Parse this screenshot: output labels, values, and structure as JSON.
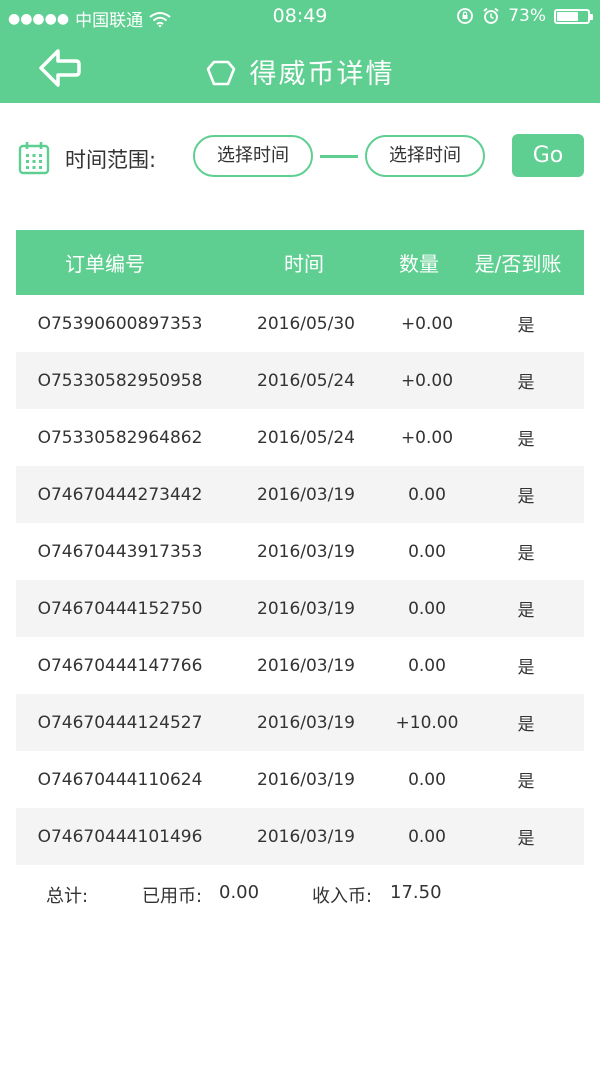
{
  "status_bar": {
    "carrier": "中国联通",
    "time": "08:49",
    "battery": "73%",
    "battery_level": 0.73
  },
  "header": {
    "title": "得威币详情"
  },
  "filter": {
    "label": "时间范围:",
    "start_placeholder": "选择时间",
    "end_placeholder": "选择时间",
    "go_label": "Go"
  },
  "table": {
    "columns": [
      "订单编号",
      "时间",
      "数量",
      "是/否到账"
    ],
    "rows": [
      {
        "order": "O75390600897353",
        "time": "2016/05/30",
        "qty": "+0.00",
        "status": "是"
      },
      {
        "order": "O75330582950958",
        "time": "2016/05/24",
        "qty": "+0.00",
        "status": "是"
      },
      {
        "order": "O75330582964862",
        "time": "2016/05/24",
        "qty": "+0.00",
        "status": "是"
      },
      {
        "order": "O74670444273442",
        "time": "2016/03/19",
        "qty": "0.00",
        "status": "是"
      },
      {
        "order": "O74670443917353",
        "time": "2016/03/19",
        "qty": "0.00",
        "status": "是"
      },
      {
        "order": "O74670444152750",
        "time": "2016/03/19",
        "qty": "0.00",
        "status": "是"
      },
      {
        "order": "O74670444147766",
        "time": "2016/03/19",
        "qty": "0.00",
        "status": "是"
      },
      {
        "order": "O74670444124527",
        "time": "2016/03/19",
        "qty": "+10.00",
        "status": "是"
      },
      {
        "order": "O74670444110624",
        "time": "2016/03/19",
        "qty": "0.00",
        "status": "是"
      },
      {
        "order": "O74670444101496",
        "time": "2016/03/19",
        "qty": "0.00",
        "status": "是"
      }
    ]
  },
  "totals": {
    "label": "总计:",
    "used_label": "已用币:",
    "used_value": "0.00",
    "income_label": "收入币:",
    "income_value": "17.50"
  },
  "colors": {
    "accent": "#5fcf91",
    "row_alt": "#f4f4f4"
  }
}
